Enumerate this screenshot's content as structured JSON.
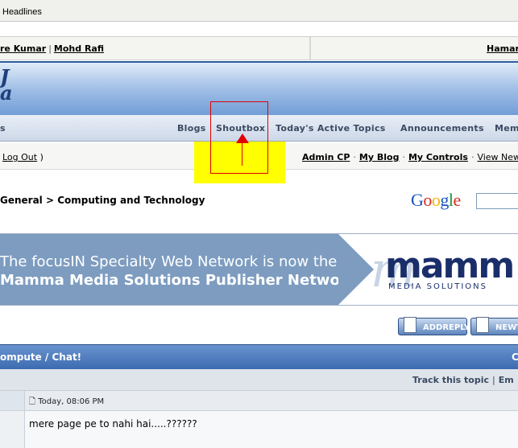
{
  "headlines": {
    "label": "Headlines"
  },
  "linkrow": {
    "name1": "re Kumar",
    "name2": "Mohd Rafi",
    "right": "Hamar"
  },
  "logo": {
    "line1": "J",
    "line2": "a"
  },
  "nav": {
    "partial": "s",
    "items": [
      "Blogs",
      "Shoutbox",
      "Today's Active Topics",
      "Announcements",
      "Mem"
    ]
  },
  "user": {
    "logout_open": "Log Out",
    "logout_close": ")",
    "admin_cp": "Admin CP",
    "my_blog": "My Blog",
    "my_controls": "My Controls",
    "view_new": "View New Po"
  },
  "breadcrumb": "General > Computing and Technology",
  "google": {
    "letters": [
      "G",
      "o",
      "o",
      "g",
      "l",
      "e"
    ],
    "colors": [
      "#1a53c4",
      "#d62d20",
      "#f2b50f",
      "#1a53c4",
      "#1c9a3a",
      "#d62d20"
    ]
  },
  "ad": {
    "line1": "The focusIN Specialty Web Network is now the",
    "line2": "Mamma Media Solutions Publisher Network",
    "brand": "mamm",
    "sub": "MEDIA SOLUTIONS"
  },
  "buttons": {
    "reply": "ADDREPLY",
    "newtopic": "NEWTO"
  },
  "thread": {
    "title": "ompute / Chat!",
    "right": "C"
  },
  "tools": {
    "track": "Track this topic",
    "sep": "|",
    "email": "Em"
  },
  "post": {
    "date": "Today, 08:06 PM",
    "message": "mere page pe to nahi hai.....??????"
  }
}
